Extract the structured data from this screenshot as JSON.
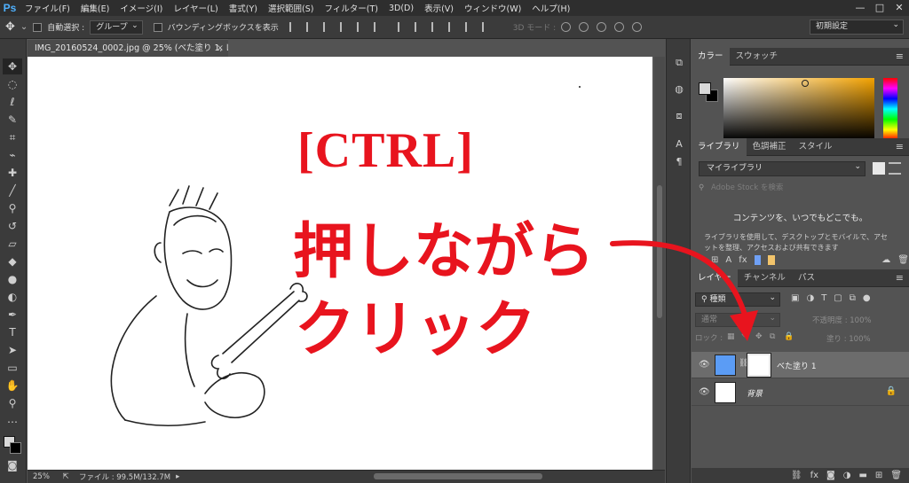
{
  "app": {
    "logo": "Ps",
    "menu": [
      "ファイル(F)",
      "編集(E)",
      "イメージ(I)",
      "レイヤー(L)",
      "書式(Y)",
      "選択範囲(S)",
      "フィルター(T)",
      "3D(D)",
      "表示(V)",
      "ウィンドウ(W)",
      "ヘルプ(H)"
    ],
    "window_controls": [
      "—",
      "□",
      "✕"
    ]
  },
  "options_bar": {
    "auto_select_label": "自動選択 :",
    "auto_select_value": "グループ",
    "bounding_box_label": "バウンディングボックスを表示",
    "mode_3d_label": "3D モード :",
    "workspace": "初期設定"
  },
  "document": {
    "tab_title": "IMG_20160524_0002.jpg @ 25% (べた塗り 1, レイヤーマスク/8) *",
    "tab_close": "×",
    "zoom": "25%",
    "file_info": "ファイル : 99.5M/132.7M",
    "status_arrow": "▸"
  },
  "annotation": {
    "line1": "[CTRL]",
    "line2": "押しながら",
    "line3": "クリック",
    "color": "#e8141e"
  },
  "panels": {
    "color": {
      "tabs": [
        "カラー",
        "スウォッチ"
      ],
      "foreground": "#d9d9d9",
      "background": "#000000",
      "hue_color": "#f3a200"
    },
    "library": {
      "tabs": [
        "ライブラリ",
        "色調補正",
        "スタイル"
      ],
      "selected_library": "マイライブラリ",
      "search_placeholder": "Adobe Stock を検索",
      "headline": "コンテンツを、いつでもどこでも。",
      "description": "ライブラリを使用して、デスクトップとモバイルで、アセットを整理、アクセスおよび共有できます"
    },
    "layers": {
      "tabs": [
        "レイヤー",
        "チャンネル",
        "パス"
      ],
      "filter": "種類",
      "blend_mode": "通常",
      "opacity_label": "不透明度 : 100%",
      "lock_label": "ロック :",
      "fill_label": "塗り : 100%",
      "items": [
        {
          "name": "べた塗り 1",
          "thumb_color": "#5b9cf5",
          "selected": true
        },
        {
          "name": "背景",
          "thumb_color": "#ffffff",
          "selected": false
        }
      ]
    }
  }
}
